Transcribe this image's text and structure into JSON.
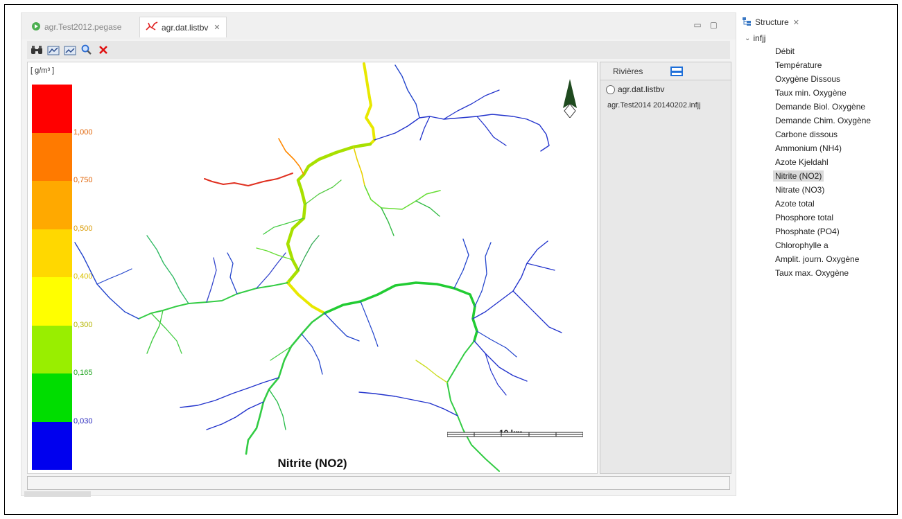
{
  "tabs": [
    {
      "label": "agr.Test2012.pegase",
      "active": false,
      "icon": "pegase-run-icon"
    },
    {
      "label": "agr.dat.listbv",
      "active": true,
      "icon": "river-network-icon"
    }
  ],
  "toolbar": {
    "buttons": [
      "binoculars-icon",
      "chart-export-icon",
      "chart-import-icon",
      "zoom-icon",
      "delete-icon"
    ]
  },
  "map": {
    "unit_label": "[ g/m³ ]",
    "title": "Nitrite (NO2)",
    "scale_label": "10 km",
    "legend": {
      "colors": [
        "#ff0000",
        "#ff7a00",
        "#ffa900",
        "#ffd800",
        "#ffff00",
        "#99ee00",
        "#00dd00",
        "#0000ee"
      ],
      "ticks": [
        {
          "label": "1,000",
          "color": "#e06000"
        },
        {
          "label": "0,750",
          "color": "#e06000"
        },
        {
          "label": "0,500",
          "color": "#d99a00"
        },
        {
          "label": "0,400",
          "color": "#d9c000"
        },
        {
          "label": "0,300",
          "color": "#b5b500"
        },
        {
          "label": "0,165",
          "color": "#22a522"
        },
        {
          "label": "0,030",
          "color": "#2222bb"
        }
      ]
    }
  },
  "layers": {
    "header": "Rivières",
    "items": [
      "agr.dat.listbv",
      "agr.Test2014 20140202.infjj"
    ]
  },
  "structure": {
    "title": "Structure",
    "root": "infjj",
    "items": [
      "Débit",
      "Température",
      "Oxygène Dissous",
      "Taux min. Oxygène",
      "Demande Biol. Oxygène",
      "Demande Chim. Oxygène",
      "Carbone dissous",
      "Ammonium (NH4)",
      "Azote Kjeldahl",
      "Nitrite (NO2)",
      "Nitrate (NO3)",
      "Azote total",
      "Phosphore total",
      "Phosphate (PO4)",
      "Chlorophylle a",
      "Amplit. journ. Oxygène",
      "Taux max. Oxygène"
    ],
    "selected": "Nitrite (NO2)"
  }
}
